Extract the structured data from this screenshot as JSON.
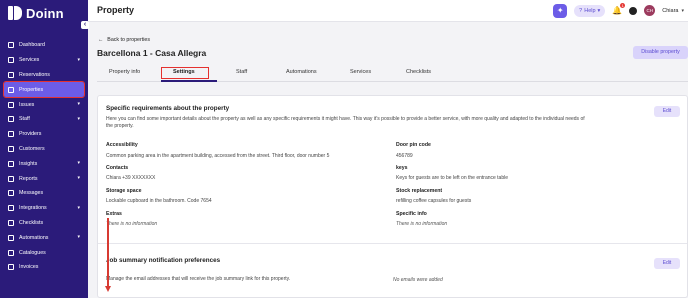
{
  "brand": {
    "name": "Doinn"
  },
  "sidebar": {
    "items": [
      {
        "label": "Dashboard",
        "icon": "dashboard-icon",
        "chevron": false
      },
      {
        "label": "Services",
        "icon": "services-icon",
        "chevron": true
      },
      {
        "label": "Reservations",
        "icon": "reservations-icon",
        "chevron": false
      },
      {
        "label": "Properties",
        "icon": "home-icon",
        "chevron": false,
        "active": true
      },
      {
        "label": "Issues",
        "icon": "issues-icon",
        "chevron": true
      },
      {
        "label": "Staff",
        "icon": "staff-icon",
        "chevron": true
      },
      {
        "label": "Providers",
        "icon": "providers-icon",
        "chevron": false
      },
      {
        "label": "Customers",
        "icon": "customers-icon",
        "chevron": false
      },
      {
        "label": "Insights",
        "icon": "insights-icon",
        "chevron": true
      },
      {
        "label": "Reports",
        "icon": "reports-icon",
        "chevron": true
      },
      {
        "label": "Messages",
        "icon": "messages-icon",
        "chevron": false
      },
      {
        "label": "Integrations",
        "icon": "integrations-icon",
        "chevron": true
      },
      {
        "label": "Checklists",
        "icon": "checklists-icon",
        "chevron": false
      },
      {
        "label": "Automations",
        "icon": "automations-icon",
        "chevron": true
      },
      {
        "label": "Catalogues",
        "icon": "catalogues-icon",
        "chevron": false
      },
      {
        "label": "Invoices",
        "icon": "invoices-icon",
        "chevron": false
      }
    ]
  },
  "header": {
    "title": "Property",
    "help_label": "Help",
    "notification_count": "1",
    "avatar_initials": "CH",
    "user_name": "Chiara"
  },
  "page": {
    "back_label": "Back to properties",
    "property_name": "Barcellona 1 - Casa Allegra",
    "disable_label": "Disable property",
    "tabs": [
      {
        "label": "Property info"
      },
      {
        "label": "Settings",
        "active": true
      },
      {
        "label": "Staff"
      },
      {
        "label": "Automations"
      },
      {
        "label": "Services"
      },
      {
        "label": "Checklists"
      }
    ]
  },
  "requirements": {
    "title": "Specific requirements about the property",
    "description": "Here you can find some important details about the property as well as any specific requirements it might have. This way it's possible to provide a better service, with more quality and adapted to the individual needs of the property.",
    "edit_label": "Edit",
    "fields": {
      "accessibility": {
        "label": "Accessibility",
        "value": "Common parking area in the apartment building, accessed from the street. Third floor, door number 5"
      },
      "door_pin": {
        "label": "Door pin code",
        "value": "456789"
      },
      "contacts": {
        "label": "Contacts",
        "value": "Chiara +39 XXXXXXX"
      },
      "keys": {
        "label": "keys",
        "value": "Keys for guests are to be left on the entrance table"
      },
      "storage": {
        "label": "Storage space",
        "value": "Lockable cupboard in the bathroom. Code 7654"
      },
      "stock": {
        "label": "Stock replacement",
        "value": "refilling coffee capsules for guests"
      },
      "extras": {
        "label": "Extras",
        "value": "There is no information"
      },
      "specific_info": {
        "label": "Specific info",
        "value": "There is no information"
      }
    }
  },
  "job_summary": {
    "title": "Job summary notification preferences",
    "description": "Manage the email addresses that will receive the job summary link for this property.",
    "empty_text": "No emails were added",
    "edit_label": "Edit"
  },
  "colors": {
    "sidebar_bg": "#2b1b7a",
    "accent": "#6c5ce7",
    "highlight_red": "#e5312f"
  }
}
